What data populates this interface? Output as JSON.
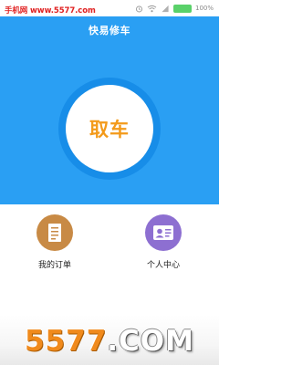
{
  "status_bar": {
    "watermark": "手机网 www.5577.com",
    "battery_percent": "100%",
    "icons": [
      "alarm-icon",
      "wifi-icon",
      "signal-icon",
      "battery-icon"
    ],
    "battery_color": "#5ad16a"
  },
  "header": {
    "title": "快易修车"
  },
  "main": {
    "pickup_label": "取车",
    "accent_color": "#f39a1a",
    "hero_color": "#2a9ff3"
  },
  "menu": {
    "orders": {
      "label": "我的订单",
      "icon": "document-icon",
      "color": "#c88a45"
    },
    "profile": {
      "label": "个人中心",
      "icon": "id-card-icon",
      "color": "#8d6fd1"
    }
  },
  "watermark_bottom": {
    "number": "5577",
    "domain": ".COM"
  }
}
